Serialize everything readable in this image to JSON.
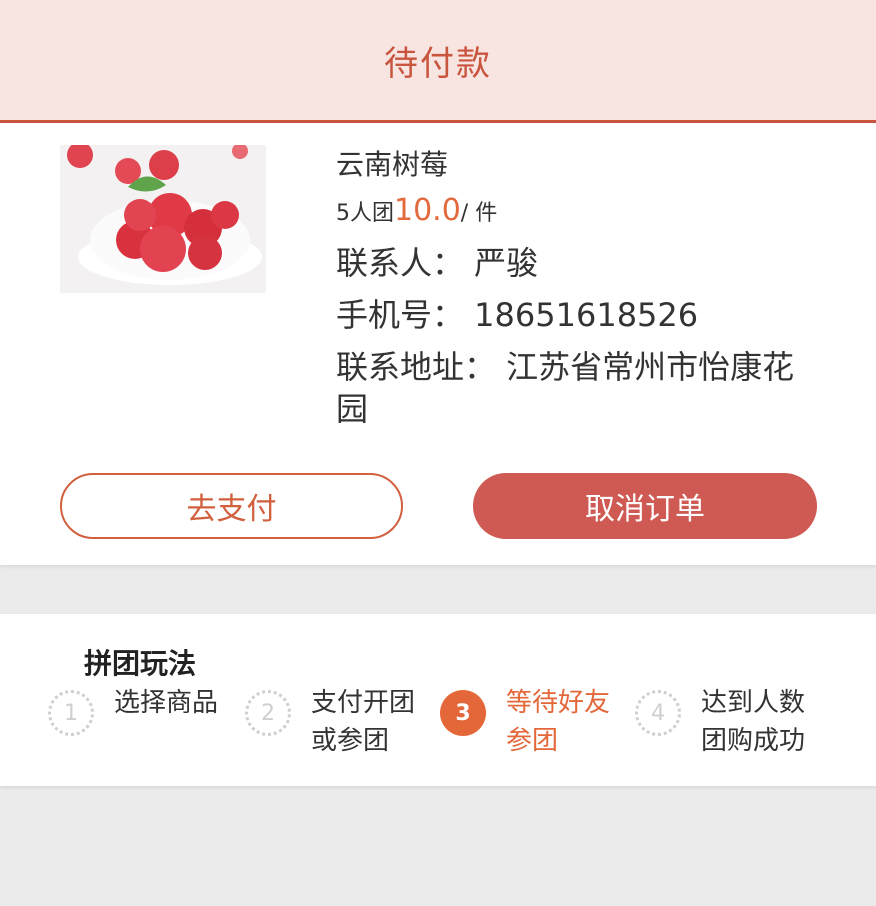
{
  "header": {
    "title": "待付款"
  },
  "order": {
    "product_name": "云南树莓",
    "group_size": "5人团",
    "price": "10.0",
    "unit": "/ 件",
    "contact": "联系人：  严骏",
    "phone": "手机号：  18651618526",
    "address": "联系地址：  江苏省常州市怡康花园"
  },
  "actions": {
    "pay_label": "去支付",
    "cancel_label": "取消订单"
  },
  "rules": {
    "title": "拼团玩法",
    "steps": [
      {
        "num": "1",
        "line1": "选择商品",
        "line2": ""
      },
      {
        "num": "2",
        "line1": "支付开团",
        "line2": "或参团"
      },
      {
        "num": "3",
        "line1": "等待好友",
        "line2": "参团"
      },
      {
        "num": "4",
        "line1": "达到人数",
        "line2": "团购成功"
      }
    ],
    "active_step": 3
  },
  "colors": {
    "accent": "#c9553f",
    "cancel_button": "#cf5a53",
    "active_step": "#e4673a",
    "header_bg": "#f8e5e2"
  }
}
